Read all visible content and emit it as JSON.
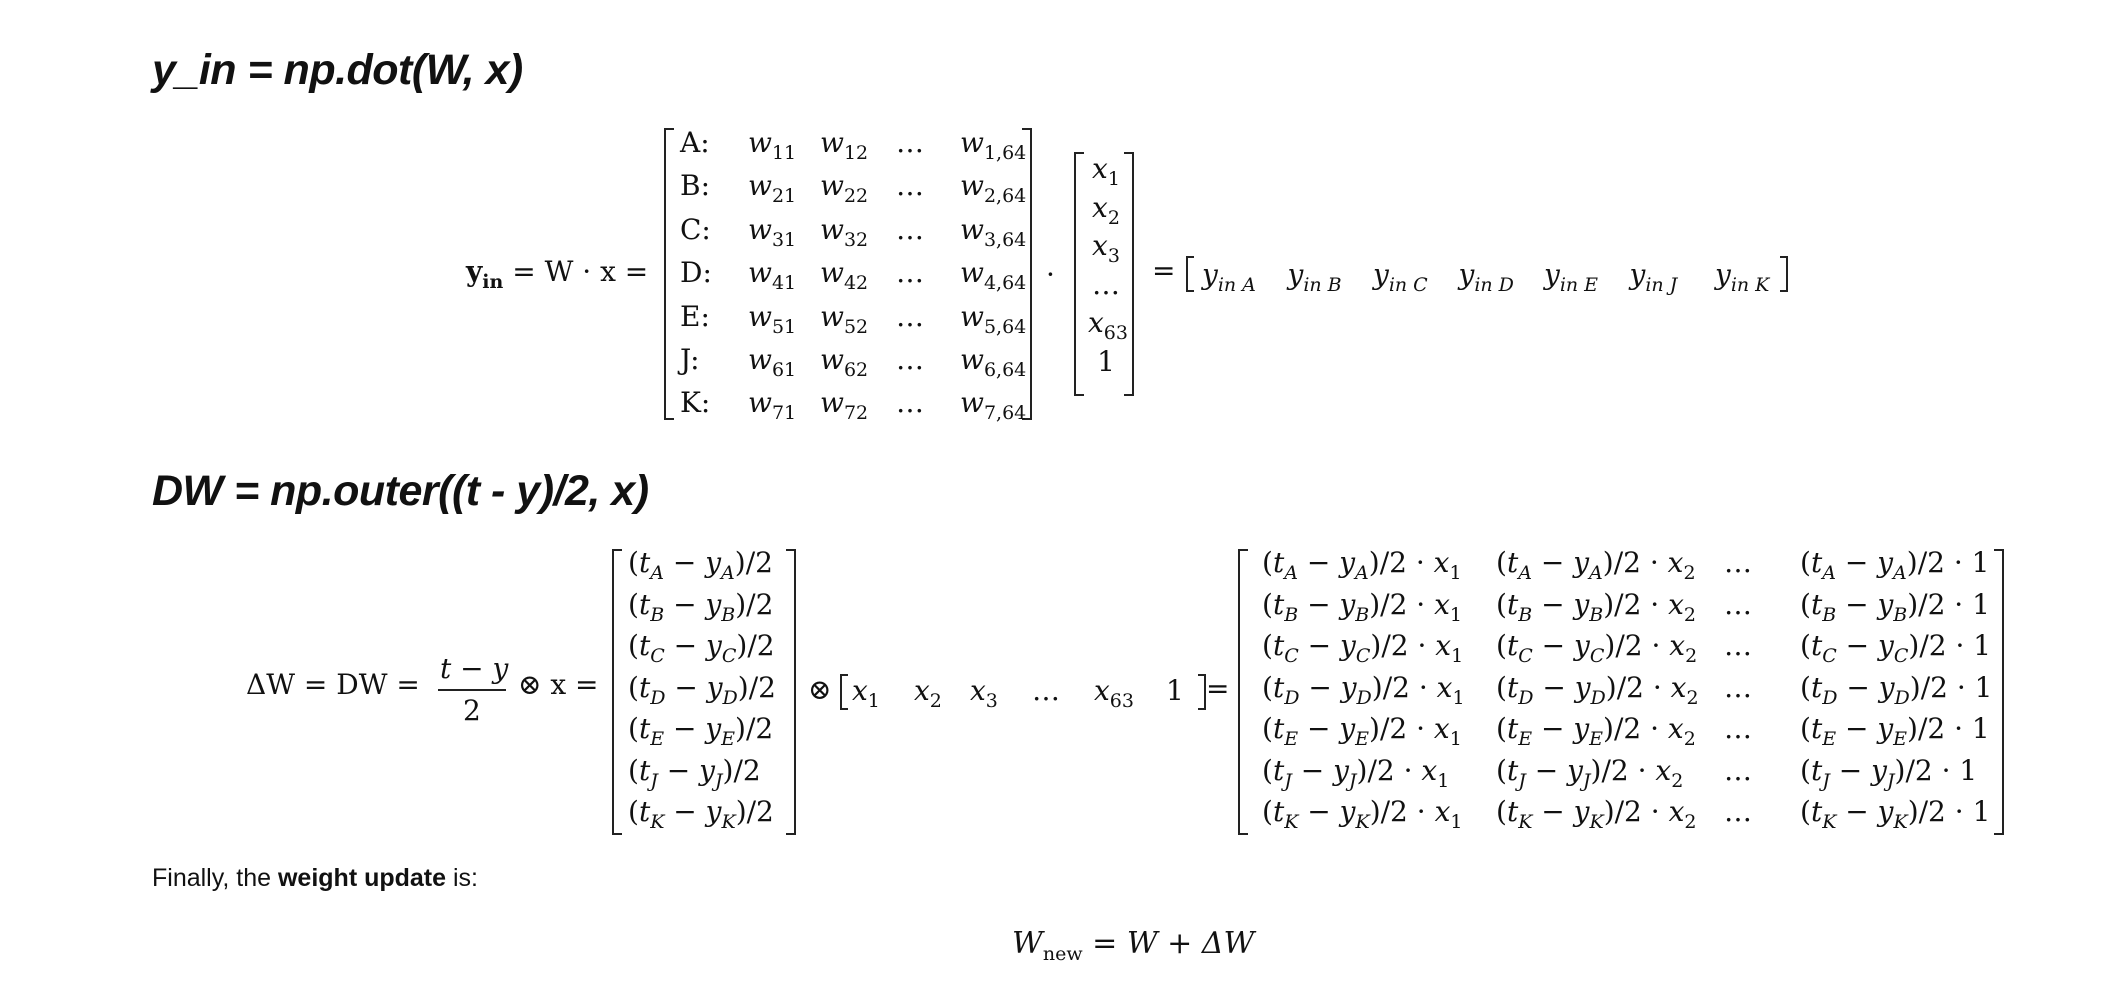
{
  "headings": {
    "h1": "y_in = np.dot(W, x)",
    "h2": "DW = np.outer((t - y)/2, x)"
  },
  "eq1": {
    "lhs_y": "y",
    "lhs_sub": "in",
    "lhs_rest": "= W · x =",
    "row_labels": [
      "A:",
      "B:",
      "C:",
      "D:",
      "E:",
      "J:",
      "K:"
    ],
    "weights": [
      [
        "w11",
        "w12",
        "…",
        "w1,64"
      ],
      [
        "w21",
        "w22",
        "…",
        "w2,64"
      ],
      [
        "w31",
        "w32",
        "…",
        "w3,64"
      ],
      [
        "w41",
        "w42",
        "…",
        "w4,64"
      ],
      [
        "w51",
        "w52",
        "…",
        "w5,64"
      ],
      [
        "w61",
        "w62",
        "…",
        "w6,64"
      ],
      [
        "w71",
        "w72",
        "…",
        "w7,64"
      ]
    ],
    "dot": "·",
    "x_vector": [
      "x1",
      "x2",
      "x3",
      "…",
      "x63",
      "1"
    ],
    "equals": "=",
    "y_vector": [
      "y in A",
      "y in B",
      "y in C",
      "y in D",
      "y in E",
      "y in J",
      "y in K"
    ]
  },
  "eq2": {
    "lhs": "ΔW = DW =",
    "frac_num": "t − y",
    "frac_den": "2",
    "otimes_x": "⊗ x =",
    "col": [
      "A",
      "B",
      "C",
      "D",
      "E",
      "J",
      "K"
    ],
    "otimes": "⊗",
    "row_vector": [
      "x1",
      "x2",
      "x3",
      "…",
      "x63",
      "1"
    ],
    "equals": "=",
    "result_cols": [
      "x1",
      "x2",
      "…",
      "1"
    ]
  },
  "paragraph": {
    "before": "Finally, the ",
    "bold": "weight update",
    "after": " is:"
  },
  "final_eq": {
    "W": "W",
    "sub": "new",
    "rest": "= W + ΔW"
  }
}
